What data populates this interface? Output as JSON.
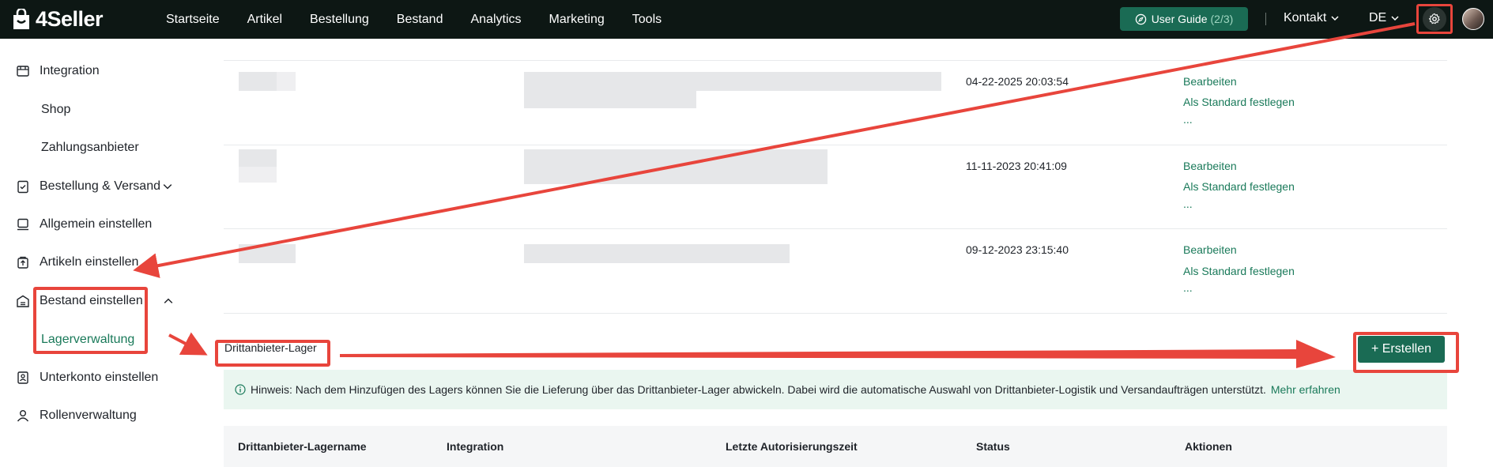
{
  "brand": "4Seller",
  "nav": [
    "Startseite",
    "Artikel",
    "Bestellung",
    "Bestand",
    "Analytics",
    "Marketing",
    "Tools"
  ],
  "header": {
    "guide_label": "User Guide",
    "guide_count": "(2/3)",
    "contact": "Kontakt",
    "language": "DE"
  },
  "sidebar": {
    "integration": "Integration",
    "shop": "Shop",
    "payment": "Zahlungsanbieter",
    "order_shipping": "Bestellung & Versand",
    "general": "Allgemein einstellen",
    "articles": "Artikeln einstellen",
    "inventory": "Bestand einstellen",
    "warehouse_mgmt": "Lagerverwaltung",
    "subaccount": "Unterkonto einstellen",
    "roles": "Rollenverwaltung"
  },
  "rows": [
    {
      "date": "04-22-2025 20:03:54",
      "edit": "Bearbeiten",
      "default": "Als Standard festlegen",
      "more": "..."
    },
    {
      "date": "11-11-2023 20:41:09",
      "edit": "Bearbeiten",
      "default": "Als Standard festlegen",
      "more": "..."
    },
    {
      "date": "09-12-2023 23:15:40",
      "edit": "Bearbeiten",
      "default": "Als Standard festlegen",
      "more": "..."
    }
  ],
  "third_party": {
    "title": "Drittanbieter-Lager",
    "create": "+ Erstellen",
    "hint": "Hinweis: Nach dem Hinzufügen des Lagers können Sie die Lieferung über das Drittanbieter-Lager abwickeln. Dabei wird die automatische Auswahl von Drittanbieter-Logistik und Versandaufträgen unterstützt.",
    "learn_more": "Mehr erfahren",
    "columns": [
      "Drittanbieter-Lagername",
      "Integration",
      "Letzte Autorisierungszeit",
      "Status",
      "Aktionen"
    ]
  },
  "colors": {
    "brand_green": "#1a6b54",
    "link_green": "#1a7a5a",
    "annotation_red": "#e8453c"
  }
}
